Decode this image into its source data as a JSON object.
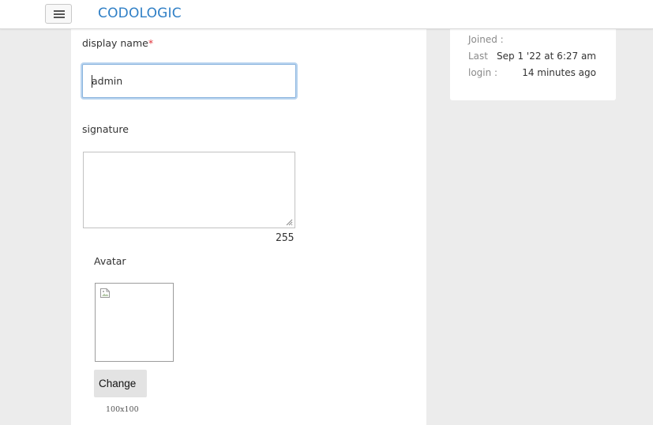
{
  "navbar": {
    "brand": "CODOLOGIC",
    "toggle_icon": "hamburger-icon"
  },
  "form": {
    "display_name": {
      "label": "display name",
      "required_marker": "*",
      "value": "admin"
    },
    "signature": {
      "label": "signature",
      "value": "",
      "remaining_chars": "255"
    },
    "avatar": {
      "label": "Avatar",
      "image_icon": "broken-image-icon",
      "change_label": "Change",
      "size_hint": "100x100"
    }
  },
  "profile_info": {
    "joined_label": "Joined :",
    "last_label": "Last",
    "login_label": "login :",
    "last_login_date": "Sep 1 '22 at 6:27 am",
    "last_login_ago": "14 minutes ago"
  },
  "colors": {
    "brand": "#2f7fc6",
    "required": "#e0353b",
    "focus_border": "#8ab4de",
    "page_background": "#ececec"
  }
}
